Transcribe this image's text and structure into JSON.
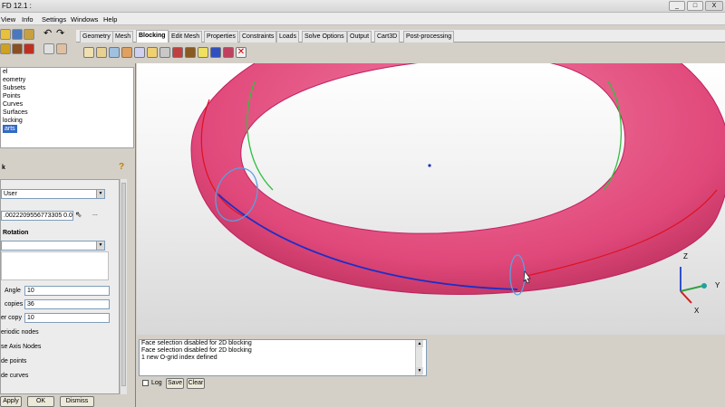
{
  "window": {
    "title": "FD 12.1 :",
    "minimize": "_",
    "maximize": "□",
    "close": "X"
  },
  "menu": [
    "View",
    "Info",
    "Settings",
    "Windows",
    "Help"
  ],
  "tabs": [
    "Geometry",
    "Mesh",
    "Blocking",
    "Edit Mesh",
    "Properties",
    "Constraints",
    "Loads",
    "Solve Options",
    "Output",
    "Cart3D",
    "Post-processing"
  ],
  "active_tab": "Blocking",
  "tree": {
    "items": [
      "el",
      "eometry",
      "Subsets",
      "Points",
      "Curves",
      "Surfaces",
      "locking"
    ],
    "selected": "arts"
  },
  "panel": {
    "title": "k",
    "method_value": "User",
    "vector_value": ".0022209556773305 0.0",
    "dots": "...",
    "rotation_label": "Rotation",
    "angle_label": "Angle",
    "angle_value": "10",
    "copies_label": "copies",
    "copies_value": "36",
    "per_copy_label": "er copy",
    "per_copy_value": "10",
    "periodic_label": "eriodic nodes",
    "axis_label": "se Axis Nodes",
    "points_label": "de points",
    "curves_label": "de curves"
  },
  "buttons": {
    "apply": "Apply",
    "ok": "OK",
    "dismiss": "Dismiss"
  },
  "messages": [
    "Face selection disabled for 2D blocking",
    "Face selection disabled for 2D blocking",
    "1 new O-grid index defined"
  ],
  "msg_controls": {
    "log": "Log",
    "save": "Save",
    "clear": "Clear"
  },
  "axes": {
    "x": "X",
    "y": "Y",
    "z": "Z"
  },
  "colors": {
    "torus": "#e0487a",
    "selection_curve": "#1a2fc8",
    "selection_ring": "#5aa0e0",
    "edge_red": "#e01020",
    "edge_green": "#30c040",
    "selected_tree": "#316ac5"
  }
}
